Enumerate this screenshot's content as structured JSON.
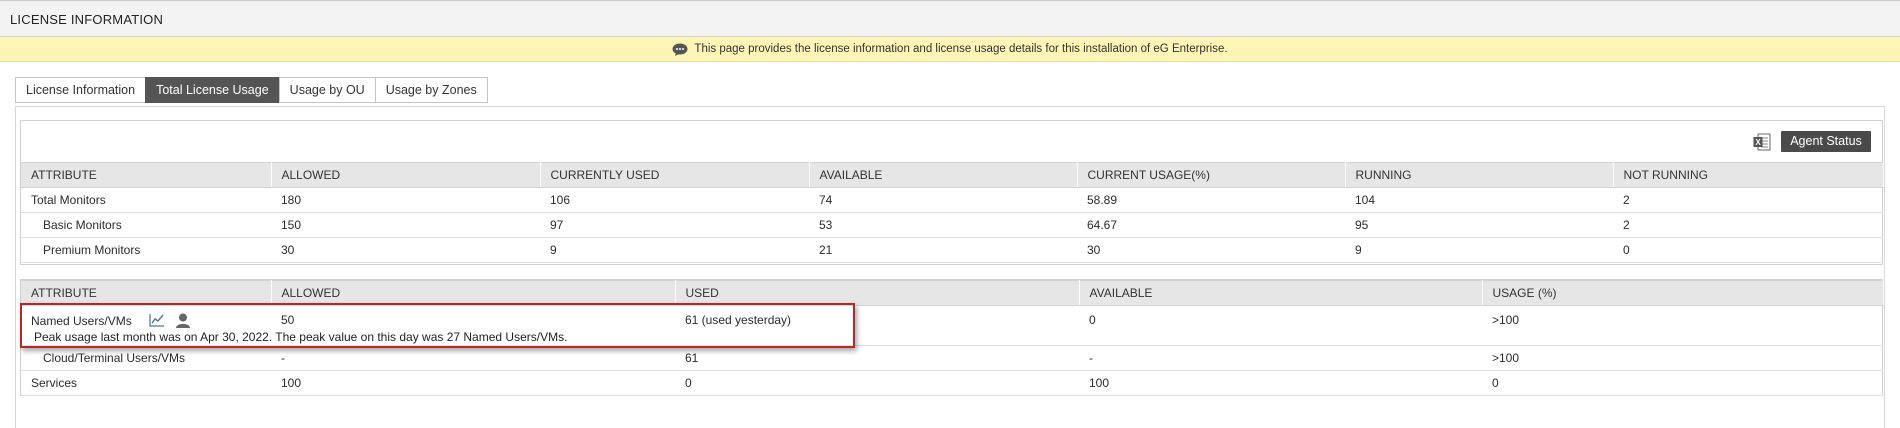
{
  "header": {
    "title": "LICENSE INFORMATION"
  },
  "banner": {
    "text": "This page provides the license information and license usage details for this installation of eG Enterprise."
  },
  "tabs": [
    {
      "label": "License Information",
      "active": false
    },
    {
      "label": "Total License Usage",
      "active": true
    },
    {
      "label": "Usage by OU",
      "active": false
    },
    {
      "label": "Usage by Zones",
      "active": false
    }
  ],
  "toolbar": {
    "export_icon": "excel-export-icon",
    "agent_status_label": "Agent Status"
  },
  "monitors_table": {
    "headers": [
      "ATTRIBUTE",
      "ALLOWED",
      "CURRENTLY USED",
      "AVAILABLE",
      "CURRENT USAGE(%)",
      "RUNNING",
      "NOT RUNNING"
    ],
    "rows": [
      [
        "Total Monitors",
        "180",
        "106",
        "74",
        "58.89",
        "104",
        "2"
      ],
      [
        "Basic Monitors",
        "150",
        "97",
        "53",
        "64.67",
        "95",
        "2"
      ],
      [
        "Premium Monitors",
        "30",
        "9",
        "21",
        "30",
        "9",
        "0"
      ]
    ]
  },
  "users_table": {
    "headers": [
      "ATTRIBUTE",
      "ALLOWED",
      "USED",
      "AVAILABLE",
      "USAGE (%)"
    ],
    "rows": [
      [
        "Named Users/VMs",
        "50",
        "61 (used yesterday)",
        "0",
        ">100"
      ],
      [
        "Cloud/Terminal Users/VMs",
        "-",
        "61",
        "-",
        ">100"
      ],
      [
        "Services",
        "100",
        "0",
        "100",
        "0"
      ]
    ],
    "row_icons": [
      "trend-chart-icon",
      "user-icon"
    ],
    "peak_note": "Peak usage last month was on Apr 30, 2022. The peak value on this day was 27 Named Users/VMs."
  },
  "colors": {
    "active_tab": "#555555",
    "banner": "#fcf5b5",
    "highlight": "#b02a2a",
    "button": "#4a4a4a"
  }
}
